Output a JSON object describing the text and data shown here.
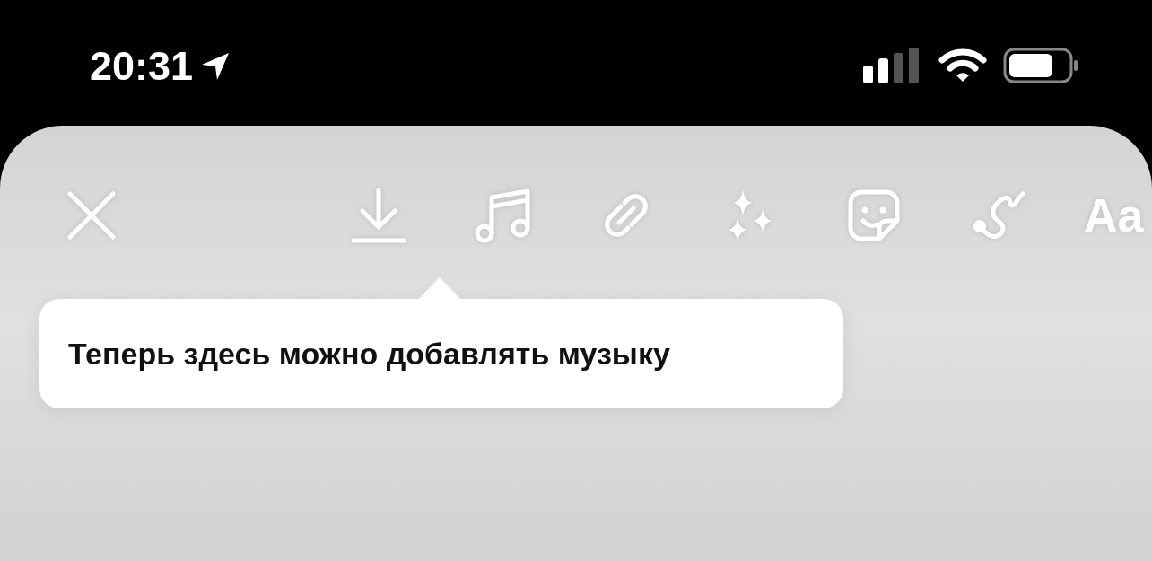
{
  "status_bar": {
    "time": "20:31"
  },
  "toolbar": {
    "buttons": [
      {
        "kind": "close"
      },
      {
        "kind": "download"
      },
      {
        "kind": "music"
      },
      {
        "kind": "link"
      },
      {
        "kind": "effects"
      },
      {
        "kind": "sticker"
      },
      {
        "kind": "draw"
      },
      {
        "kind": "text",
        "label": "Aa"
      }
    ]
  },
  "tooltip": {
    "text": "Теперь здесь можно добавлять музыку"
  }
}
